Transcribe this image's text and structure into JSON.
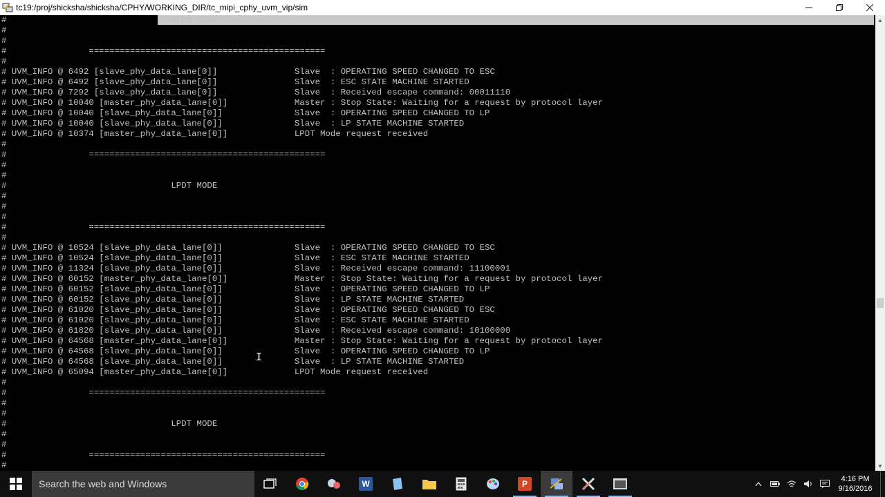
{
  "window": {
    "title": "tc19:/proj/shicksha/shicksha/CPHY/WORKING_DIR/tc_mipi_cphy_uvm_vip/sim"
  },
  "terminal": {
    "lines": [
      "#                                ULPS MODE",
      "#",
      "#",
      "#                ==============================================",
      "#",
      "# UVM_INFO @ 6492 [slave_phy_data_lane[0]]               Slave  : OPERATING SPEED CHANGED TO ESC",
      "# UVM_INFO @ 6492 [slave_phy_data_lane[0]]               Slave  : ESC STATE MACHINE STARTED",
      "# UVM_INFO @ 7292 [slave_phy_data_lane[0]]               Slave  : Received escape command: 00011110",
      "# UVM_INFO @ 10040 [master_phy_data_lane[0]]             Master : Stop State: Waiting for a request by protocol layer",
      "# UVM_INFO @ 10040 [slave_phy_data_lane[0]]              Slave  : OPERATING SPEED CHANGED TO LP",
      "# UVM_INFO @ 10040 [slave_phy_data_lane[0]]              Slave  : LP STATE MACHINE STARTED",
      "# UVM_INFO @ 10374 [master_phy_data_lane[0]]             LPDT Mode request received",
      "#",
      "#                ==============================================",
      "#",
      "#",
      "#                                LPDT MODE",
      "#",
      "#",
      "#",
      "#                ==============================================",
      "#",
      "# UVM_INFO @ 10524 [slave_phy_data_lane[0]]              Slave  : OPERATING SPEED CHANGED TO ESC",
      "# UVM_INFO @ 10524 [slave_phy_data_lane[0]]              Slave  : ESC STATE MACHINE STARTED",
      "# UVM_INFO @ 11324 [slave_phy_data_lane[0]]              Slave  : Received escape command: 11100001",
      "# UVM_INFO @ 60152 [master_phy_data_lane[0]]             Master : Stop State: Waiting for a request by protocol layer",
      "# UVM_INFO @ 60152 [slave_phy_data_lane[0]]              Slave  : OPERATING SPEED CHANGED TO LP",
      "# UVM_INFO @ 60152 [slave_phy_data_lane[0]]              Slave  : LP STATE MACHINE STARTED",
      "# UVM_INFO @ 61020 [slave_phy_data_lane[0]]              Slave  : OPERATING SPEED CHANGED TO ESC",
      "# UVM_INFO @ 61020 [slave_phy_data_lane[0]]              Slave  : ESC STATE MACHINE STARTED",
      "# UVM_INFO @ 61820 [slave_phy_data_lane[0]]              Slave  : Received escape command: 10100000",
      "# UVM_INFO @ 64568 [master_phy_data_lane[0]]             Master : Stop State: Waiting for a request by protocol layer",
      "# UVM_INFO @ 64568 [slave_phy_data_lane[0]]              Slave  : OPERATING SPEED CHANGED TO LP",
      "# UVM_INFO @ 64568 [slave_phy_data_lane[0]]              Slave  : LP STATE MACHINE STARTED",
      "# UVM_INFO @ 65094 [master_phy_data_lane[0]]             LPDT Mode request received",
      "#",
      "#                ==============================================",
      "#",
      "#",
      "#                                LPDT MODE",
      "#",
      "#",
      "#                ==============================================",
      "#"
    ]
  },
  "taskbar": {
    "search_placeholder": "Search the web and Windows",
    "apps": [
      {
        "name": "task-view",
        "icon": "task-view-icon"
      },
      {
        "name": "chrome",
        "icon": "chrome-icon",
        "color": "#db4437"
      },
      {
        "name": "tools",
        "icon": "tools-icon",
        "color": "#9ab"
      },
      {
        "name": "word",
        "icon": "word-icon",
        "color": "#2b579a",
        "letter": "W"
      },
      {
        "name": "notes",
        "icon": "notes-icon",
        "color": "#6fa8dc"
      },
      {
        "name": "file-explorer",
        "icon": "folder-icon",
        "color": "#f2c94c"
      },
      {
        "name": "calculator",
        "icon": "calculator-icon",
        "color": "#bbbbbb"
      },
      {
        "name": "paint",
        "icon": "paint-icon",
        "color": "#9ec5e8"
      },
      {
        "name": "powerpoint",
        "icon": "powerpoint-icon",
        "color": "#d24726",
        "letter": "P"
      },
      {
        "name": "remote-desktop",
        "icon": "network-icon",
        "color": "#6b8fd6"
      },
      {
        "name": "xming",
        "icon": "x-icon",
        "color": "#dddddd",
        "letter": "X"
      },
      {
        "name": "terminal",
        "icon": "terminal-window-icon",
        "color": "#cccccc"
      }
    ],
    "clock_time": "4:16 PM",
    "clock_date": "9/16/2016"
  }
}
